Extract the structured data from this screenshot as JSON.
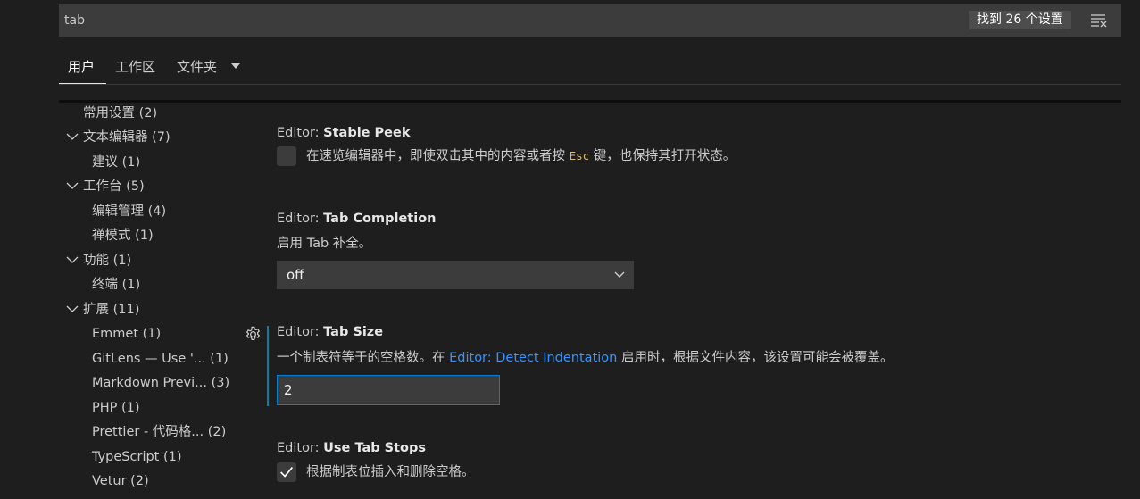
{
  "search": {
    "value": "tab",
    "result_count": "找到 26 个设置",
    "clear_icon": "clear-filter-icon"
  },
  "tabs": [
    {
      "label": "用户",
      "active": true
    },
    {
      "label": "工作区",
      "active": false
    },
    {
      "label": "文件夹",
      "active": false
    }
  ],
  "toc": [
    {
      "label": "常用设置",
      "count": "(2)",
      "expandable": false
    },
    {
      "label": "文本编辑器",
      "count": "(7)",
      "expandable": true
    },
    {
      "label": "建议",
      "count": "(1)",
      "expandable": false
    },
    {
      "label": "工作台",
      "count": "(5)",
      "expandable": true
    },
    {
      "label": "编辑管理",
      "count": "(4)",
      "expandable": false
    },
    {
      "label": "禅模式",
      "count": "(1)",
      "expandable": false
    },
    {
      "label": "功能",
      "count": "(1)",
      "expandable": true
    },
    {
      "label": "终端",
      "count": "(1)",
      "expandable": false
    },
    {
      "label": "扩展",
      "count": "(11)",
      "expandable": true
    },
    {
      "label": "Emmet",
      "count": "(1)",
      "expandable": false
    },
    {
      "label": "GitLens — Use '...",
      "count": "(1)",
      "expandable": false
    },
    {
      "label": "Markdown Previ...",
      "count": "(3)",
      "expandable": false
    },
    {
      "label": "PHP",
      "count": "(1)",
      "expandable": false
    },
    {
      "label": "Prettier - 代码格...",
      "count": "(2)",
      "expandable": false
    },
    {
      "label": "TypeScript",
      "count": "(1)",
      "expandable": false
    },
    {
      "label": "Vetur",
      "count": "(2)",
      "expandable": false
    }
  ],
  "settings": {
    "stable_peek": {
      "category": "Editor: ",
      "name": "Stable Peek",
      "desc_before": "在速览编辑器中，即使双击其中的内容或者按 ",
      "desc_code": "Esc",
      "desc_after": " 键，也保持其打开状态。",
      "checked": false
    },
    "tab_completion": {
      "category": "Editor: ",
      "name": "Tab Completion",
      "desc": "启用 Tab 补全。",
      "value": "off"
    },
    "tab_size": {
      "category": "Editor: ",
      "name": "Tab Size",
      "desc_before": "一个制表符等于的空格数。在 ",
      "desc_link": "Editor: Detect Indentation",
      "desc_after": " 启用时，根据文件内容，该设置可能会被覆盖。",
      "value": "2"
    },
    "use_tab_stops": {
      "category": "Editor: ",
      "name": "Use Tab Stops",
      "desc": "根据制表位插入和删除空格。",
      "checked": true
    }
  },
  "colors": {
    "background": "#1e1e1e",
    "input": "#3c3c3c",
    "link": "#3794ff",
    "focus_border": "#007fd4",
    "modified": "#0c7d9d"
  }
}
